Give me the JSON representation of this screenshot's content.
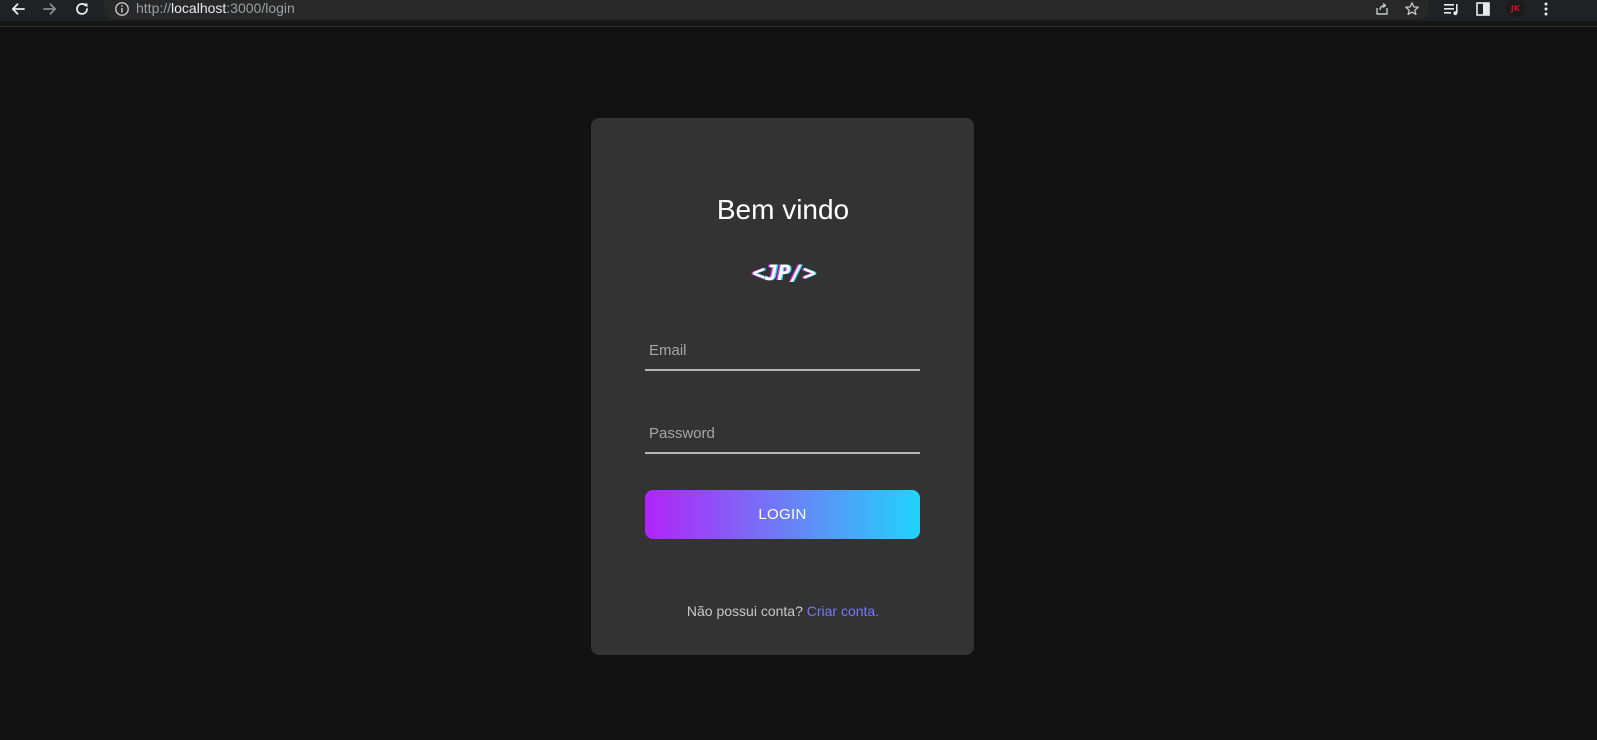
{
  "browser": {
    "url_scheme": "http://",
    "url_host": "localhost",
    "url_path": ":3000/login",
    "profile_initials": "JK",
    "icons": [
      "back-arrow-icon",
      "forward-arrow-icon",
      "reload-icon",
      "info-icon",
      "share-icon",
      "star-icon",
      "media-queue-icon",
      "side-panel-icon",
      "more-vert-icon"
    ]
  },
  "login": {
    "title": "Bem vindo",
    "logo_text": "<JP/>",
    "email_placeholder": "Email",
    "password_placeholder": "Password",
    "button_label": "LOGIN",
    "no_account_text": "Não possui conta?",
    "create_account_link": "Criar conta."
  },
  "colors": {
    "page_background": "#121212",
    "card_background": "#333333",
    "button_gradient_start": "#b124f9",
    "button_gradient_end": "#1fd4fc",
    "link": "#7579f4"
  }
}
